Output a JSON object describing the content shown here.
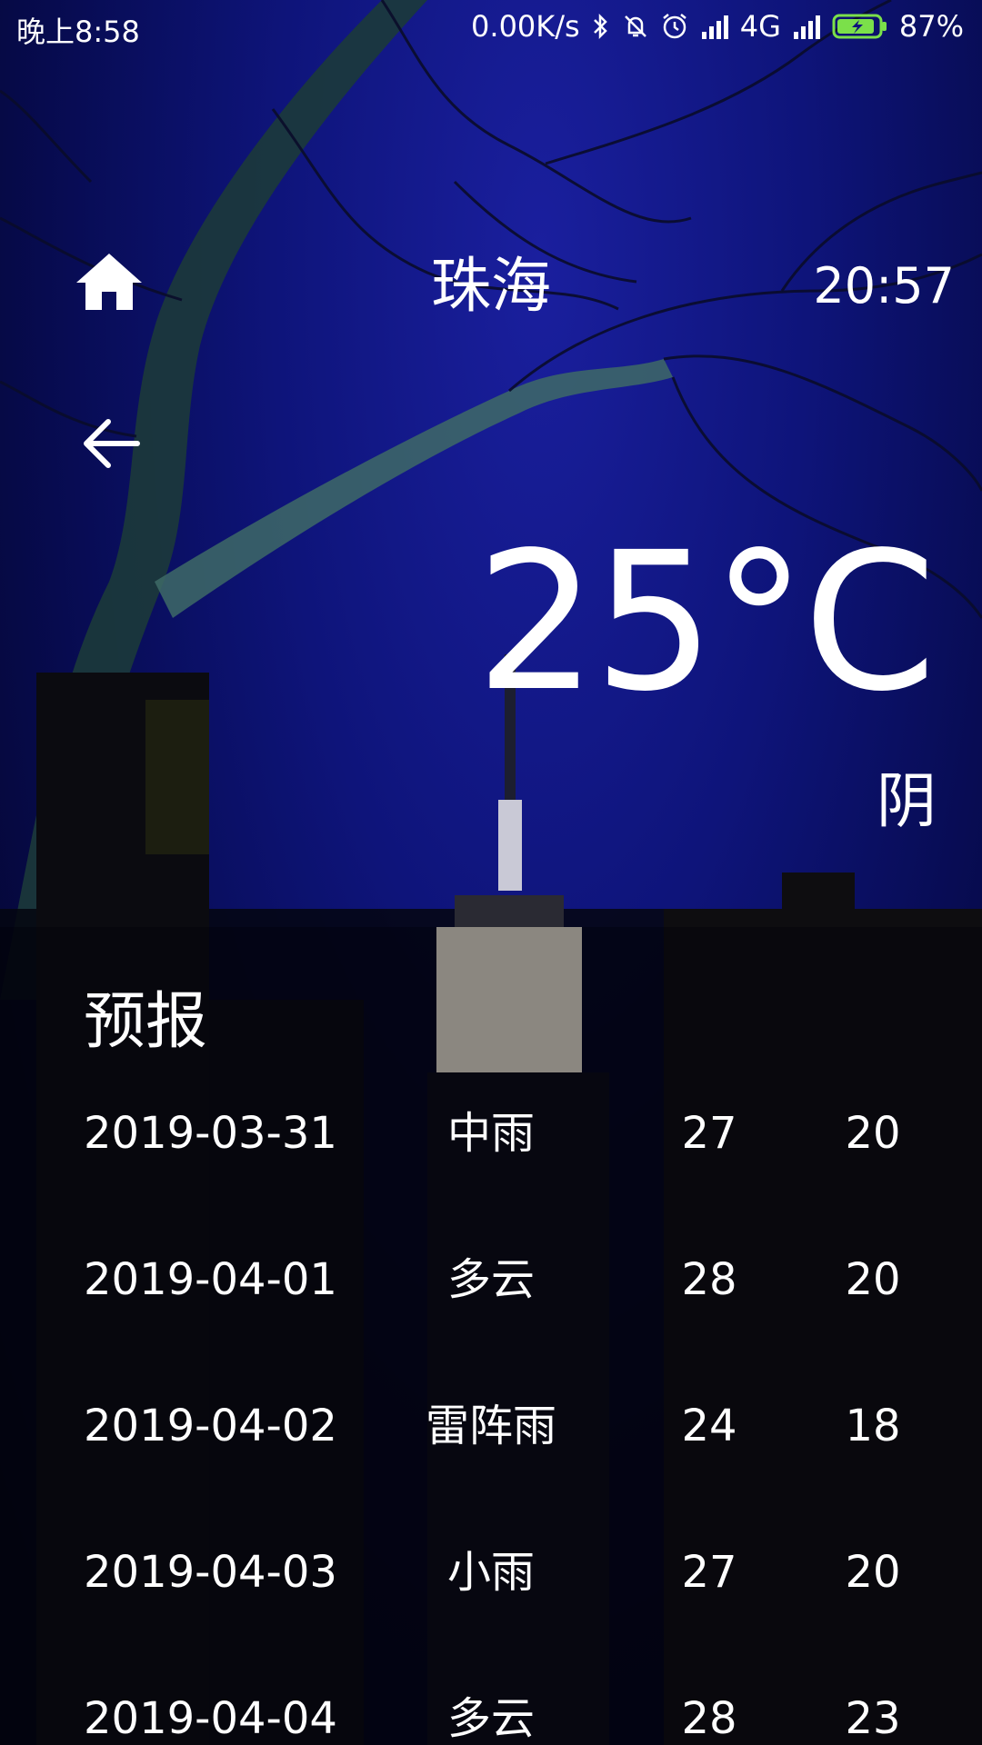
{
  "status_bar": {
    "time": "晚上8:58",
    "network_speed": "0.00K/s",
    "network_type": "4G",
    "battery": "87%"
  },
  "header": {
    "city": "珠海",
    "update_time": "20:57"
  },
  "current": {
    "temperature": "25°C",
    "condition": "阴"
  },
  "forecast": {
    "title": "预报",
    "rows": [
      {
        "date": "2019-03-31",
        "weather": "中雨",
        "max": "27",
        "min": "20"
      },
      {
        "date": "2019-04-01",
        "weather": "多云",
        "max": "28",
        "min": "20"
      },
      {
        "date": "2019-04-02",
        "weather": "雷阵雨",
        "max": "24",
        "min": "18"
      },
      {
        "date": "2019-04-03",
        "weather": "小雨",
        "max": "27",
        "min": "20"
      },
      {
        "date": "2019-04-04",
        "weather": "多云",
        "max": "28",
        "min": "23"
      }
    ]
  },
  "icons": {
    "home": "home-icon",
    "back": "arrow-left-icon",
    "bluetooth": "bluetooth-icon",
    "mute": "bell-off-icon",
    "alarm": "alarm-icon",
    "signal": "signal-icon",
    "battery": "battery-charging-icon"
  },
  "colors": {
    "sky": "#0e147a",
    "text": "#ffffff",
    "battery_accent": "#7be04a"
  }
}
